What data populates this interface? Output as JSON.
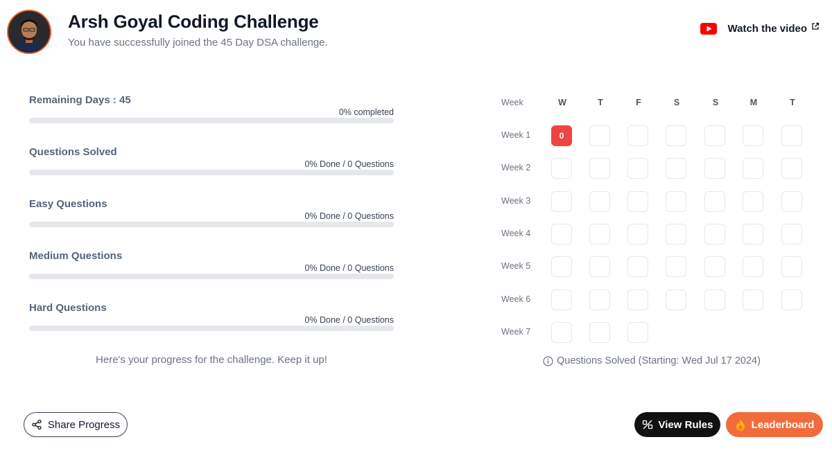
{
  "header": {
    "title": "Arsh Goyal Coding Challenge",
    "subtitle": "You have successfully joined the 45 Day DSA challenge.",
    "watch_label": "Watch the video",
    "icons": [
      "avatar",
      "youtube-icon",
      "external-link-icon"
    ]
  },
  "progress": {
    "items": [
      {
        "label": "Remaining Days : 45",
        "right": "0% completed",
        "percent": 0
      },
      {
        "label": "Questions Solved",
        "right": "0% Done / 0 Questions",
        "percent": 0
      },
      {
        "label": "Easy Questions",
        "right": "0% Done / 0 Questions",
        "percent": 0
      },
      {
        "label": "Medium Questions",
        "right": "0% Done / 0 Questions",
        "percent": 0
      },
      {
        "label": "Hard Questions",
        "right": "0% Done / 0 Questions",
        "percent": 0
      }
    ],
    "message": "Here's your progress for the challenge. Keep it up!"
  },
  "calendar": {
    "week_header": "Week",
    "days": [
      "W",
      "T",
      "F",
      "S",
      "S",
      "M",
      "T"
    ],
    "weeks": [
      {
        "label": "Week 1",
        "cells": [
          "0",
          "",
          "",
          "",
          "",
          "",
          ""
        ]
      },
      {
        "label": "Week 2",
        "cells": [
          "",
          "",
          "",
          "",
          "",
          "",
          ""
        ]
      },
      {
        "label": "Week 3",
        "cells": [
          "",
          "",
          "",
          "",
          "",
          "",
          ""
        ]
      },
      {
        "label": "Week 4",
        "cells": [
          "",
          "",
          "",
          "",
          "",
          "",
          ""
        ]
      },
      {
        "label": "Week 5",
        "cells": [
          "",
          "",
          "",
          "",
          "",
          "",
          ""
        ]
      },
      {
        "label": "Week 6",
        "cells": [
          "",
          "",
          "",
          "",
          "",
          "",
          ""
        ]
      },
      {
        "label": "Week 7",
        "cells": [
          "",
          "",
          ""
        ]
      }
    ],
    "highlighted_cell": "0",
    "caption": "Questions Solved (Starting: Wed Jul 17 2024)",
    "caption_icon": "info-icon"
  },
  "footer": {
    "share_label": "Share Progress",
    "rules_label": "View Rules",
    "leaderboard_label": "Leaderboard",
    "icons": [
      "share-icon",
      "rules-icon",
      "fire-icon"
    ]
  },
  "colors": {
    "accent": "#ef4444",
    "leaderboard": "#f26b3a",
    "rules_bg": "#111111",
    "bar_track": "#e5e7eb",
    "avatar_ring": "#e8622c"
  }
}
